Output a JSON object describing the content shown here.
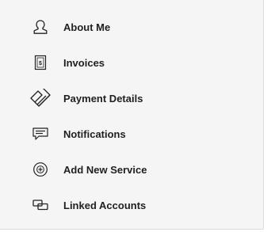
{
  "menu": {
    "items": [
      {
        "label": "About Me",
        "icon": "user-icon"
      },
      {
        "label": "Invoices",
        "icon": "invoice-icon"
      },
      {
        "label": "Payment Details",
        "icon": "cards-icon"
      },
      {
        "label": "Notifications",
        "icon": "chat-bubble-icon"
      },
      {
        "label": "Add New Service",
        "icon": "plus-circle-icon"
      },
      {
        "label": "Linked Accounts",
        "icon": "linked-accounts-icon"
      }
    ]
  },
  "colors": {
    "background": "#f5f5f5",
    "text": "#1f1f1f",
    "icon": "#222222",
    "border": "#dcdcdc"
  }
}
